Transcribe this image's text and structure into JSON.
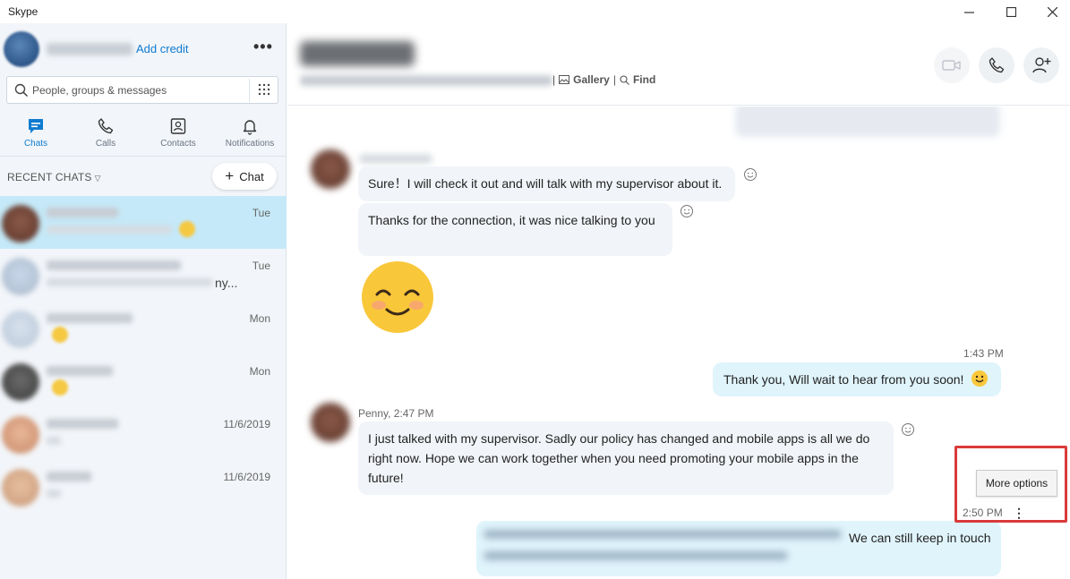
{
  "window": {
    "title": "Skype",
    "minimize": "—",
    "maximize": "☐",
    "close": "✕"
  },
  "profile": {
    "add_credit": "Add credit",
    "more": "•••"
  },
  "search": {
    "placeholder": "People, groups & messages"
  },
  "nav_tabs": [
    {
      "label": "Chats",
      "icon": "chat-icon",
      "active": true
    },
    {
      "label": "Calls",
      "icon": "phone-icon",
      "active": false
    },
    {
      "label": "Contacts",
      "icon": "contacts-icon",
      "active": false
    },
    {
      "label": "Notifications",
      "icon": "bell-icon",
      "active": false
    }
  ],
  "recent": {
    "header": "RECENT CHATS",
    "new_chat": "Chat"
  },
  "chats": [
    {
      "time": "Tue",
      "selected": true
    },
    {
      "time": "Tue",
      "extra": "ny..."
    },
    {
      "time": "Mon"
    },
    {
      "time": "Mon"
    },
    {
      "time": "11/6/2019"
    },
    {
      "time": "11/6/2019"
    }
  ],
  "header": {
    "gallery": "Gallery",
    "find": "Find",
    "sep": "|"
  },
  "messages": {
    "m1": "Sure！I will check it out and will talk with my supervisor about it.",
    "m2": "Thanks for the connection,   it was nice talking to you",
    "t1": "1:43 PM",
    "m3": "Thank you, Will wait to hear from you soon!",
    "sender2": "Penny, 2:47 PM",
    "m4": "I just talked with my supervisor. Sadly our policy has changed and mobile apps is all we do right now. Hope we can work together when you need promoting your mobile apps in the future!",
    "t2": "2:50 PM",
    "m5_visible": "We can still keep in touch"
  },
  "tooltip": {
    "label": "More options"
  },
  "colors": {
    "accent": "#0f7bd0",
    "highlight": "#d93a3a",
    "selected": "#c5e9f8",
    "outgoing": "#e0f4fc"
  }
}
